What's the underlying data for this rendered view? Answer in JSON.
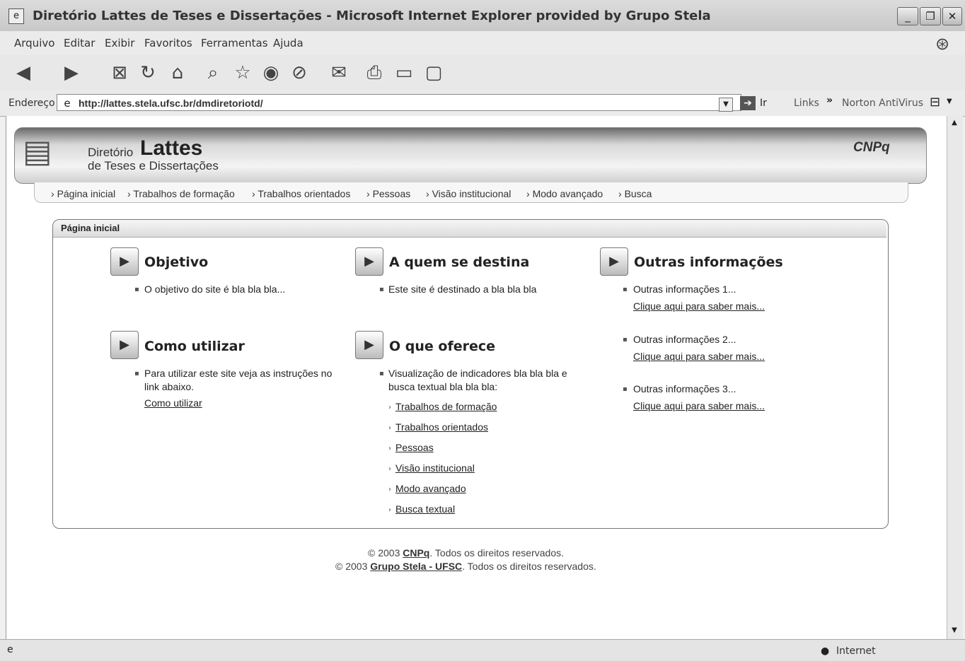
{
  "window": {
    "title": "Diretório Lattes de Teses e Dissertações - Microsoft Internet Explorer provided by Grupo Stela",
    "minimize": "_",
    "restore": "❐",
    "close": "✕"
  },
  "menu": [
    "Arquivo",
    "Editar",
    "Exibir",
    "Favoritos",
    "Ferramentas",
    "Ajuda"
  ],
  "address": {
    "label": "Endereço",
    "url": "http://lattes.stela.ufsc.br/dmdiretoriotd/",
    "go_label": "Ir",
    "links_label": "Links",
    "norton_label": "Norton AntiVirus"
  },
  "banner": {
    "brand_small": "Diretório",
    "brand_big": "Lattes",
    "brand_sub": "de Teses e Dissertações",
    "partner": "CNPq"
  },
  "nav": [
    "Página inicial",
    "Trabalhos de formação",
    "Trabalhos orientados",
    "Pessoas",
    "Visão institucional",
    "Modo avançado",
    "Busca"
  ],
  "panel_title": "Página inicial",
  "sections": {
    "objetivo": {
      "title": "Objetivo",
      "text": "O objetivo do site é bla bla bla..."
    },
    "a_quem": {
      "title": "A quem se destina",
      "text": "Este site é destinado a bla bla bla"
    },
    "outras": {
      "title": "Outras informações",
      "items": [
        {
          "text": "Outras informações 1...",
          "link": "Clique aqui para saber mais..."
        },
        {
          "text": "Outras informações 2...",
          "link": "Clique aqui para saber mais..."
        },
        {
          "text": "Outras informações 3...",
          "link": "Clique aqui para saber mais..."
        }
      ]
    },
    "como_utilizar": {
      "title": "Como utilizar",
      "text_line1": "Para utilizar este site veja as instruções no",
      "text_line2": "link abaixo.",
      "link": "Como utilizar"
    },
    "o_que_oferece": {
      "title": "O que oferece",
      "text_line1": "Visualização de indicadores bla bla bla e",
      "text_line2": "busca textual bla bla bla:",
      "links": [
        "Trabalhos de formação",
        "Trabalhos orientados",
        "Pessoas",
        "Visão institucional",
        "Modo avançado",
        "Busca textual"
      ]
    }
  },
  "footer": {
    "line1_prefix": "© 2003 ",
    "line1_link": "CNPq",
    "line1_suffix": ". Todos os direitos reservados.",
    "line2_prefix": "© 2003 ",
    "line2_link": "Grupo Stela - UFSC",
    "line2_suffix": ". Todos os direitos reservados."
  },
  "status": {
    "zone": "Internet"
  }
}
